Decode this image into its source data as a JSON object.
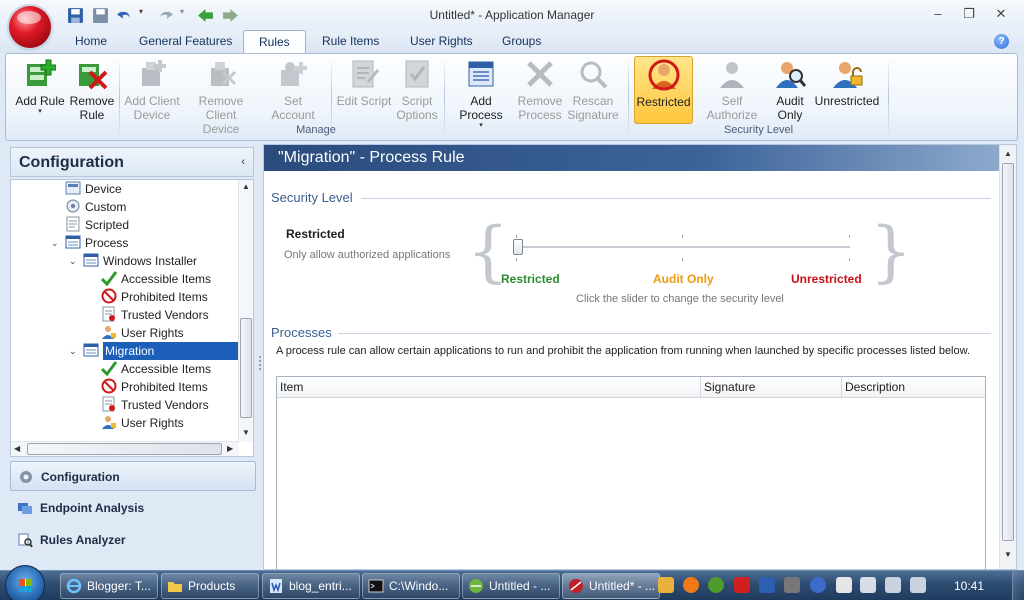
{
  "window": {
    "title": "Untitled* - Application Manager",
    "minimize": "–",
    "restore": "❐",
    "close": "✕"
  },
  "tabs": [
    "Home",
    "General Features",
    "Rules",
    "Rule Items",
    "User Rights",
    "Groups"
  ],
  "active_tab": "Rules",
  "help_label": "?",
  "ribbon": {
    "add_rule": [
      "Add Rule",
      ""
    ],
    "remove_rule": [
      "Remove",
      "Rule"
    ],
    "add_client_device": [
      "Add Client",
      "Device"
    ],
    "remove_client_device": [
      "Remove Client",
      "Device"
    ],
    "set_account": [
      "Set Account",
      ""
    ],
    "edit_script": [
      "Edit Script",
      ""
    ],
    "script_options": [
      "Script",
      "Options"
    ],
    "add_process": [
      "Add Process",
      ""
    ],
    "remove_process": [
      "Remove",
      "Process"
    ],
    "rescan_signature": [
      "Rescan",
      "Signature"
    ],
    "restricted": [
      "Restricted",
      ""
    ],
    "self_authorize": [
      "Self Authorize",
      ""
    ],
    "audit_only": [
      "Audit",
      "Only"
    ],
    "unrestricted": [
      "Unrestricted",
      ""
    ],
    "group_manage": "Manage",
    "group_security_level": "Security Level",
    "dropdown_arrow": "▾"
  },
  "left_pane": {
    "title": "Configuration",
    "collapse_glyph": "‹",
    "tree": [
      {
        "label": "Device",
        "icon": "device-icon"
      },
      {
        "label": "Custom",
        "icon": "custom-icon"
      },
      {
        "label": "Scripted",
        "icon": "script-icon"
      },
      {
        "label": "Process",
        "icon": "process-icon"
      },
      {
        "label": "Windows Installer",
        "icon": "installer-icon"
      },
      {
        "label": "Accessible Items",
        "icon": "checkmark-icon"
      },
      {
        "label": "Prohibited Items",
        "icon": "prohibited-icon"
      },
      {
        "label": "Trusted Vendors",
        "icon": "trusted-vendor-icon"
      },
      {
        "label": "User Rights",
        "icon": "user-rights-icon"
      },
      {
        "label": "Migration",
        "icon": "process-rule-icon"
      },
      {
        "label": "Accessible Items",
        "icon": "checkmark-icon"
      },
      {
        "label": "Prohibited Items",
        "icon": "prohibited-icon"
      },
      {
        "label": "Trusted Vendors",
        "icon": "trusted-vendor-icon"
      },
      {
        "label": "User Rights",
        "icon": "user-rights-icon"
      }
    ],
    "nav": [
      "Configuration",
      "Endpoint Analysis",
      "Rules Analyzer"
    ]
  },
  "content": {
    "header": "\"Migration\" - Process Rule",
    "security_level_heading": "Security Level",
    "current_level": "Restricted",
    "current_level_desc": "Only allow authorized applications",
    "slider_labels": [
      "Restricted",
      "Audit Only",
      "Unrestricted"
    ],
    "slider_colors": [
      "#2e8b2e",
      "#f09a10",
      "#c8101a"
    ],
    "slider_level": 0,
    "slider_hint": "Click the slider to change the security level",
    "processes_heading": "Processes",
    "processes_desc": "A process rule can allow certain applications to run and prohibit the application from running when launched by specific processes listed below.",
    "table_columns": [
      "Item",
      "Signature",
      "Description"
    ]
  },
  "taskbar": {
    "tasks": [
      "Blogger: T...",
      "Products",
      "blog_entri...",
      "C:\\Windo...",
      "Untitled - ...",
      "Untitled* - ..."
    ],
    "clock": "10:41"
  }
}
